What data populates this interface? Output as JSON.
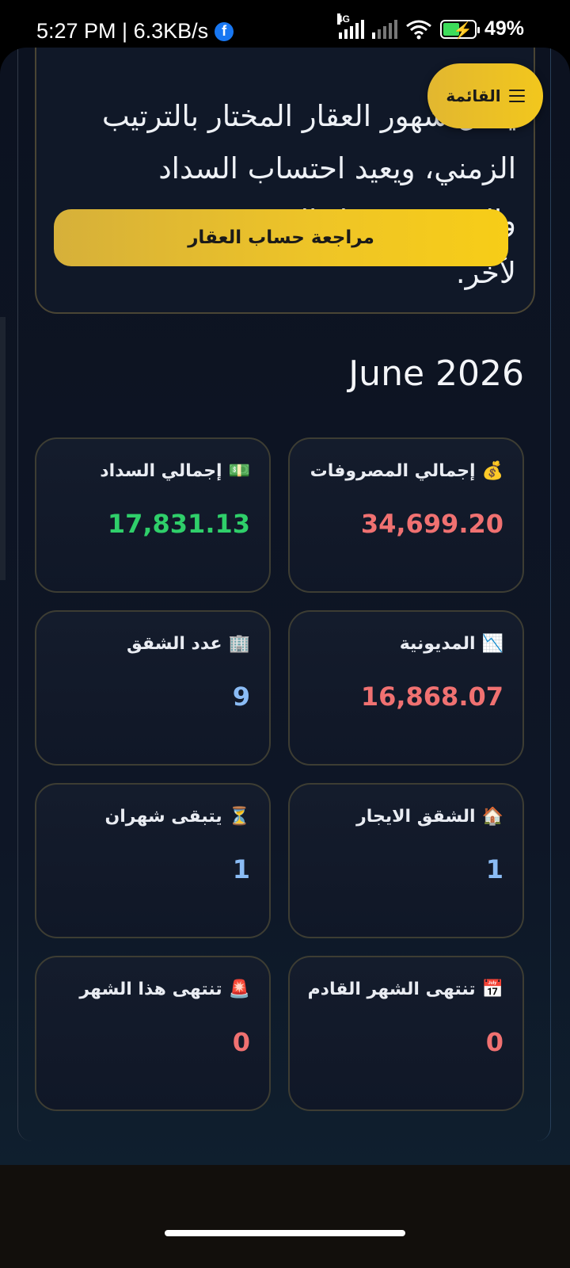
{
  "status_bar": {
    "time": "5:27 PM | 6.3KB/s",
    "network": "4G",
    "battery": "49%"
  },
  "info_card": {
    "text": "يحلل شهور العقار المختار بالترتيب الزمني، ويعيد احتساب السداد والتوزيع وترحيل المتبقي من شهر لآخر.",
    "review_button": "مراجعة حساب العقار"
  },
  "menu": {
    "label": "القائمة"
  },
  "month_title": "June 2026",
  "stats": {
    "total_expenses": {
      "icon": "💰",
      "label": "إجمالي المصروفات",
      "value": "34,699.20",
      "color": "#f07171"
    },
    "total_payment": {
      "icon": "💵",
      "label": "إجمالي السداد",
      "value": "17,831.13",
      "color": "#2fcf6a"
    },
    "debt": {
      "icon": "📉",
      "label": "المديونية",
      "value": "16,868.07",
      "color": "#f07171"
    },
    "apartments_count": {
      "icon": "🏢",
      "label": "عدد الشقق",
      "value": "9",
      "color": "#8bbcf5"
    },
    "rented_apartments": {
      "icon": "🏠",
      "label": "الشقق الايجار",
      "value": "1",
      "color": "#8bbcf5"
    },
    "two_months_left": {
      "icon": "⏳",
      "label": "يتبقى شهران",
      "value": "1",
      "color": "#8bbcf5"
    },
    "ending_next_month": {
      "icon": "📅",
      "label": "تنتهى الشهر القادم",
      "value": "0",
      "color": "#f07171"
    },
    "ending_this_month": {
      "icon": "🚨",
      "label": "تنتهى هذا الشهر",
      "value": "0",
      "color": "#f07171"
    }
  }
}
